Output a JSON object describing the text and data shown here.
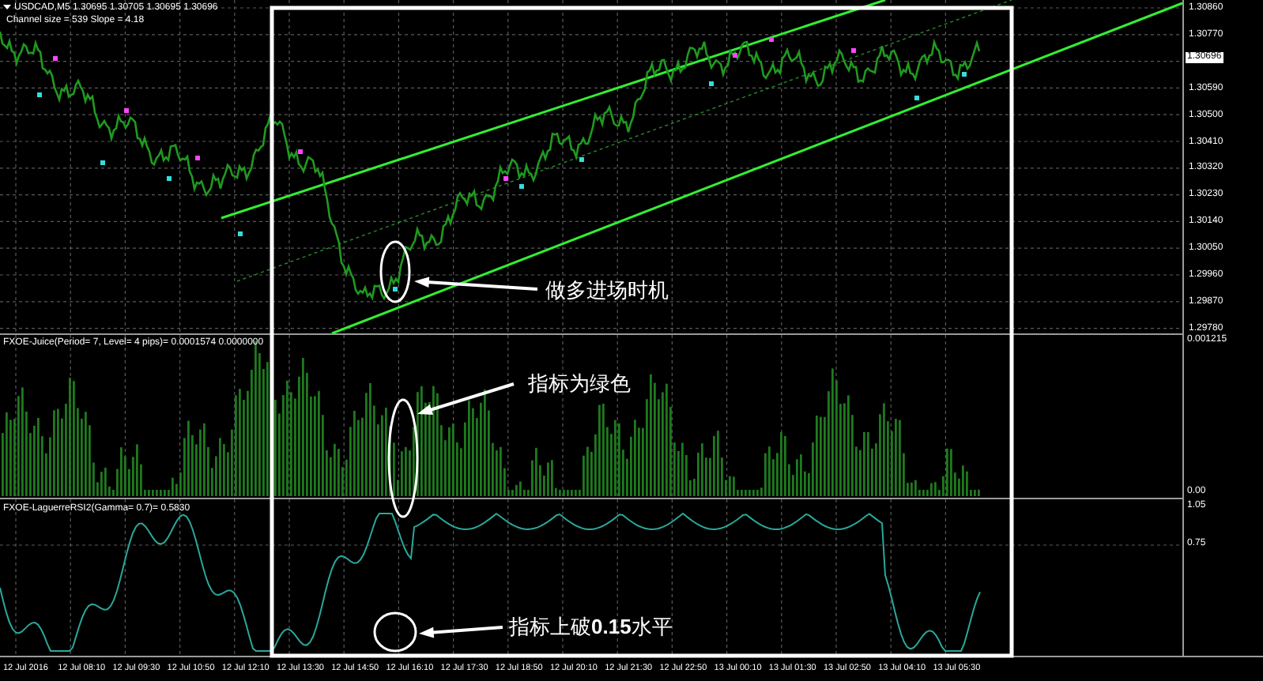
{
  "chart": {
    "symbol_header": "USDCAD,M5  1.30695 1.30705 1.30695 1.30696",
    "channel_info": "Channel size = 539 Slope = 4.18",
    "price_axis": [
      "1.30860",
      "1.30770",
      "1.30590",
      "1.30500",
      "1.30410",
      "1.30320",
      "1.30230",
      "1.30140",
      "1.30050",
      "1.29960",
      "1.29870",
      "1.29780"
    ],
    "current_price": "1.30696"
  },
  "indicator_panel": {
    "title": "FXOE-Juice(Period= 7, Level= 4 pips)= 0.0001574 0.0000000",
    "axis": [
      "0.001215",
      "0.00"
    ]
  },
  "oscillator_panel": {
    "title": "FXOE-LaguerreRSI2(Gamma= 0.7)= 0.5830",
    "axis": [
      "1.05",
      "0.75"
    ]
  },
  "time_axis": [
    "12 Jul 2016",
    "12 Jul 08:10",
    "12 Jul 09:30",
    "12 Jul 10:50",
    "12 Jul 12:10",
    "12 Jul 13:30",
    "12 Jul 14:50",
    "12 Jul 16:10",
    "12 Jul 17:30",
    "12 Jul 18:50",
    "12 Jul 20:10",
    "12 Jul 21:30",
    "12 Jul 22:50",
    "13 Jul 00:10",
    "13 Jul 01:30",
    "13 Jul 02:50",
    "13 Jul 04:10",
    "13 Jul 05:30"
  ],
  "annotations": [
    {
      "text": "做多进场时机"
    },
    {
      "text": "指标为绿色"
    },
    {
      "text": "指标上破**0.15**水平"
    }
  ]
}
